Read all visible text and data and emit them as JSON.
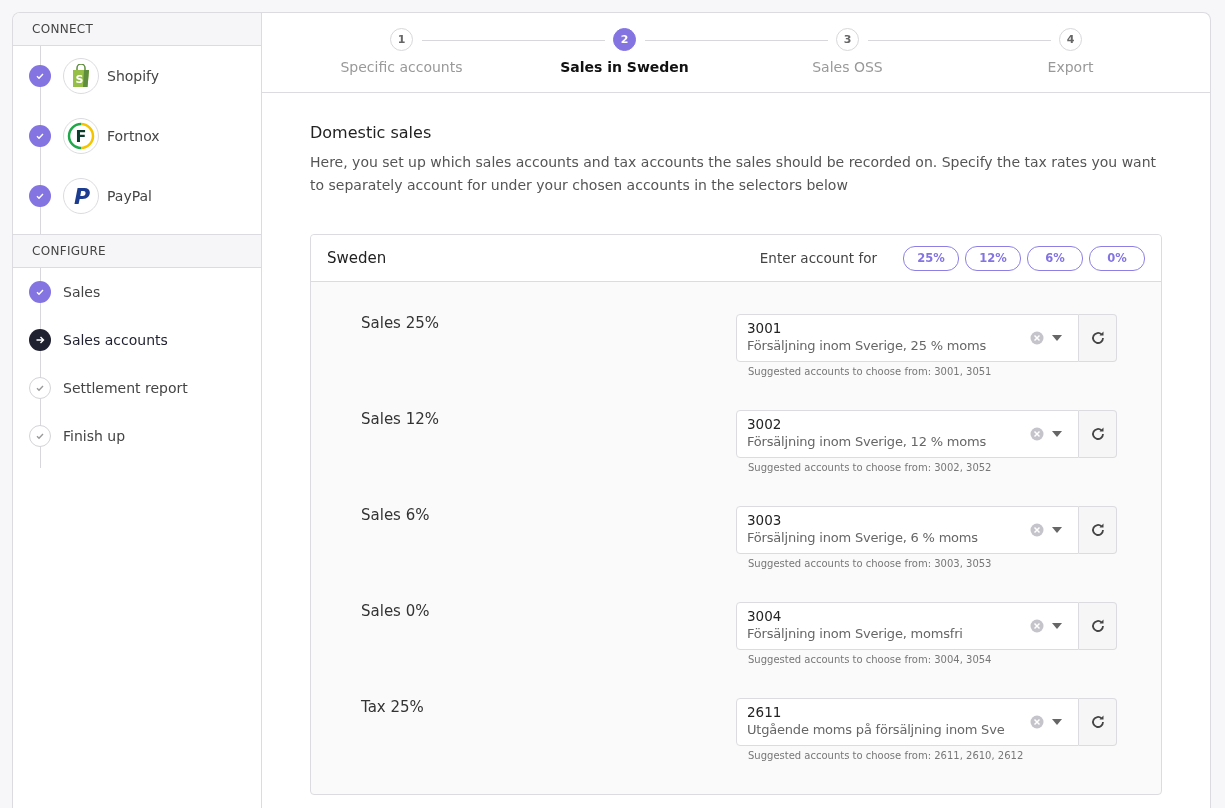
{
  "sidebar": {
    "sections": [
      {
        "title": "CONNECT",
        "items": [
          {
            "label": "Shopify",
            "done": true,
            "current": false,
            "logo": {
              "kind": "bag",
              "letter": "S"
            }
          },
          {
            "label": "Fortnox",
            "done": true,
            "current": false,
            "logo": {
              "kind": "ring",
              "letter": "F"
            }
          },
          {
            "label": "PayPal",
            "done": true,
            "current": false,
            "logo": {
              "kind": "plain",
              "letter": "P"
            }
          }
        ]
      },
      {
        "title": "CONFIGURE",
        "items": [
          {
            "label": "Sales",
            "done": true,
            "current": false
          },
          {
            "label": "Sales accounts",
            "done": false,
            "current": true
          },
          {
            "label": "Settlement report",
            "done": false,
            "current": false
          },
          {
            "label": "Finish up",
            "done": false,
            "current": false
          }
        ]
      }
    ]
  },
  "stepper": [
    {
      "number": "1",
      "label": "Specific accounts",
      "selected": false
    },
    {
      "number": "2",
      "label": "Sales in Sweden",
      "selected": true
    },
    {
      "number": "3",
      "label": "Sales OSS",
      "selected": false
    },
    {
      "number": "4",
      "label": "Export",
      "selected": false
    }
  ],
  "section": {
    "title": "Domestic sales",
    "description": "Here, you set up which sales accounts and tax accounts the sales should be recorded on. Specify the tax rates you want to separately account for under your chosen accounts in the selectors below"
  },
  "panel": {
    "title": "Sweden",
    "rates_label": "Enter account for",
    "rates": [
      "25%",
      "12%",
      "6%",
      "0%"
    ],
    "rows": [
      {
        "label": "Sales 25%",
        "account": "3001",
        "name": "Försäljning inom Sverige, 25 % moms",
        "hint": "Suggested accounts to choose from: 3001, 3051"
      },
      {
        "label": "Sales 12%",
        "account": "3002",
        "name": "Försäljning inom Sverige, 12 % moms",
        "hint": "Suggested accounts to choose from: 3002, 3052"
      },
      {
        "label": "Sales 6%",
        "account": "3003",
        "name": "Försäljning inom Sverige, 6 % moms",
        "hint": "Suggested accounts to choose from: 3003, 3053"
      },
      {
        "label": "Sales 0%",
        "account": "3004",
        "name": "Försäljning inom Sverige, momsfri",
        "hint": "Suggested accounts to choose from: 3004, 3054"
      },
      {
        "label": "Tax 25%",
        "account": "2611",
        "name": "Utgående moms på försäljning inom Sve",
        "hint": "Suggested accounts to choose from: 2611, 2610, 2612"
      }
    ]
  }
}
